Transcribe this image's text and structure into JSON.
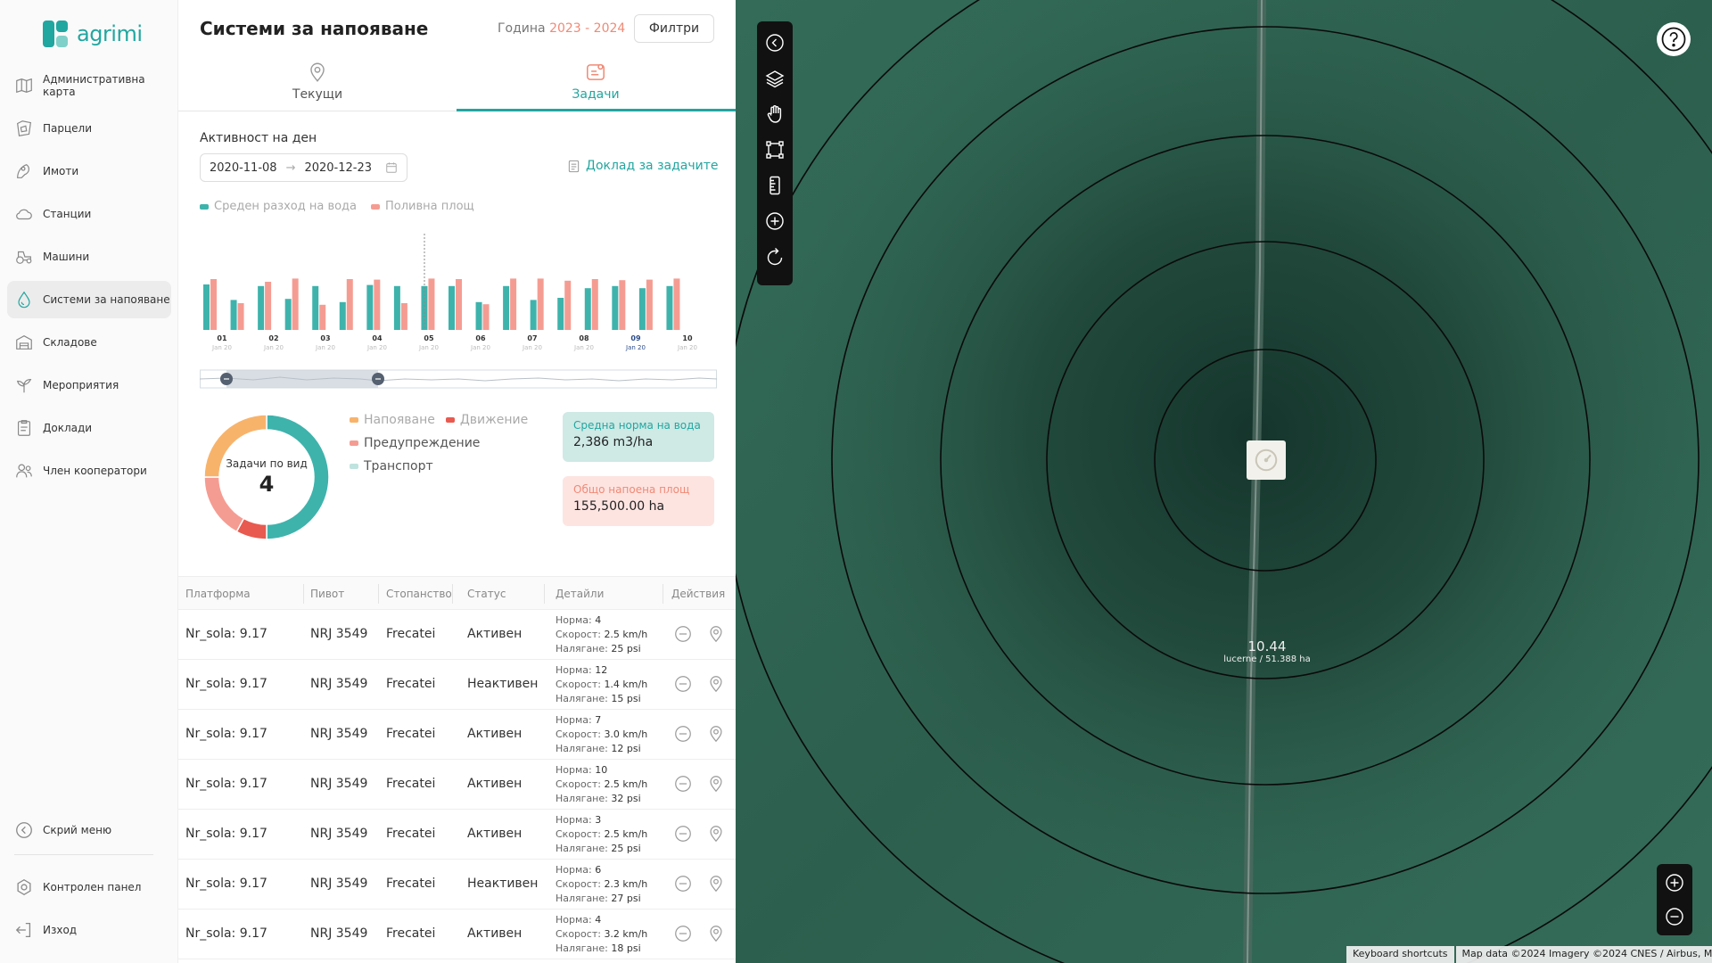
{
  "app": {
    "brand": "agrimi"
  },
  "sidebar": {
    "items": [
      {
        "label": "Административна карта",
        "icon": "map-icon"
      },
      {
        "label": "Парцели",
        "icon": "parcel-icon"
      },
      {
        "label": "Имоти",
        "icon": "property-icon"
      },
      {
        "label": "Станции",
        "icon": "cloud-icon"
      },
      {
        "label": "Машини",
        "icon": "tractor-icon"
      },
      {
        "label": "Системи за напояване",
        "icon": "drop-icon",
        "active": true
      },
      {
        "label": "Складове",
        "icon": "warehouse-icon"
      },
      {
        "label": "Мероприятия",
        "icon": "plant-icon"
      },
      {
        "label": "Доклади",
        "icon": "clipboard-icon"
      },
      {
        "label": "Член кооператори",
        "icon": "users-icon"
      }
    ],
    "hide_menu": "Скрий меню",
    "control_panel": "Контролен панел",
    "logout": "Изход"
  },
  "header": {
    "title": "Системи за напояване",
    "year_label": "Година",
    "year_value": "2023 - 2024",
    "filters_label": "Филтри"
  },
  "tabs": [
    {
      "label": "Текущи"
    },
    {
      "label": "Задачи",
      "active": true
    }
  ],
  "activity": {
    "label": "Активност на ден",
    "date_from": "2020-11-08",
    "date_arrow": "→",
    "date_to": "2020-12-23",
    "report_link": "Доклад за задачите"
  },
  "chart_legend": {
    "water": "Среден разход на вода",
    "area": "Поливна площ"
  },
  "chart_data": {
    "type": "bar",
    "categories": [
      "01",
      "02",
      "03",
      "04",
      "05",
      "06",
      "07",
      "08",
      "09",
      "10"
    ],
    "sublabel": "Jan 20",
    "highlight": "09",
    "series": [
      {
        "name": "Среден разход на вода",
        "color": "#3eb3ac",
        "values": [
          0.85,
          0.56,
          0.82,
          0.58,
          0.82,
          0.52,
          0.84,
          0.82,
          0.82,
          0.82,
          0.52,
          0.82,
          0.56,
          0.6,
          0.78,
          0.82,
          0.78,
          0.82
        ]
      },
      {
        "name": "Поливна площ",
        "color": "#f59c92",
        "values": [
          0.95,
          0.5,
          0.9,
          0.96,
          0.47,
          0.95,
          0.94,
          0.5,
          0.96,
          0.95,
          0.48,
          0.96,
          0.96,
          0.92,
          0.95,
          0.93,
          0.94,
          0.96
        ]
      }
    ]
  },
  "donut": {
    "title": "Задачи по вид",
    "value": "4",
    "legend": [
      {
        "label": "Напояване",
        "color": "#f8b36b"
      },
      {
        "label": "Движение",
        "color": "#e85a4f"
      },
      {
        "label": "Предупреждение",
        "color": "#f59c92"
      },
      {
        "label": "Транспорт",
        "color": "#bfe3df"
      }
    ],
    "segments": [
      {
        "label": "Транспорт",
        "color": "#3eb3ac",
        "fraction": 0.5
      },
      {
        "label": "Движение",
        "color": "#e85a4f",
        "fraction": 0.08
      },
      {
        "label": "Предупреждение",
        "color": "#f59c92",
        "fraction": 0.17
      },
      {
        "label": "Напояване",
        "color": "#f8b36b",
        "fraction": 0.25
      }
    ]
  },
  "cards": {
    "water_norm": {
      "label": "Средна норма на вода",
      "value": "2,386 m3/ha",
      "bg": "#cfe9e5",
      "label_color": "#22a6a0"
    },
    "irrigated_area": {
      "label": "Общо напоена площ",
      "value": "155,500.00 ha",
      "bg": "#fde4e1",
      "label_color": "#f08a76"
    }
  },
  "table": {
    "headers": [
      "Платформа",
      "Пивот",
      "Стопанство",
      "Статус",
      "Детайли",
      "Действия"
    ],
    "detail_labels": {
      "norm": "Норма:",
      "speed": "Скорост:",
      "pressure": "Налягане:"
    },
    "rows": [
      {
        "platform": "Nr_sola: 9.17",
        "pivot": "NRJ 3549",
        "farm": "Frecatei",
        "status": "Активен",
        "norm": "4",
        "speed": "2.5 km/h",
        "pressure": "25 psi"
      },
      {
        "platform": "Nr_sola: 9.17",
        "pivot": "NRJ 3549",
        "farm": "Frecatei",
        "status": "Неактивен",
        "norm": "12",
        "speed": "1.4 km/h",
        "pressure": "15 psi"
      },
      {
        "platform": "Nr_sola: 9.17",
        "pivot": "NRJ 3549",
        "farm": "Frecatei",
        "status": "Активен",
        "norm": "7",
        "speed": "3.0 km/h",
        "pressure": "12 psi"
      },
      {
        "platform": "Nr_sola: 9.17",
        "pivot": "NRJ 3549",
        "farm": "Frecatei",
        "status": "Активен",
        "norm": "10",
        "speed": "2.5 km/h",
        "pressure": "32 psi"
      },
      {
        "platform": "Nr_sola: 9.17",
        "pivot": "NRJ 3549",
        "farm": "Frecatei",
        "status": "Активен",
        "norm": "3",
        "speed": "2.5 km/h",
        "pressure": "25 psi"
      },
      {
        "platform": "Nr_sola: 9.17",
        "pivot": "NRJ 3549",
        "farm": "Frecatei",
        "status": "Неактивен",
        "norm": "6",
        "speed": "2.3 km/h",
        "pressure": "27 psi"
      },
      {
        "platform": "Nr_sola: 9.17",
        "pivot": "NRJ 3549",
        "farm": "Frecatei",
        "status": "Активен",
        "norm": "4",
        "speed": "3.2 km/h",
        "pressure": "18 psi"
      }
    ]
  },
  "map": {
    "pivot_value": "10.44",
    "pivot_sub": "lucerne / 51.388 ha",
    "attribution": [
      "Keyboard shortcuts",
      "Map data ©2024 Imagery ©2024 CNES / Airbus, M"
    ],
    "toolbar": [
      "back-icon",
      "layers-icon",
      "hand-icon",
      "polygon-icon",
      "ruler-icon",
      "add-circle-icon",
      "rotate-icon"
    ]
  }
}
